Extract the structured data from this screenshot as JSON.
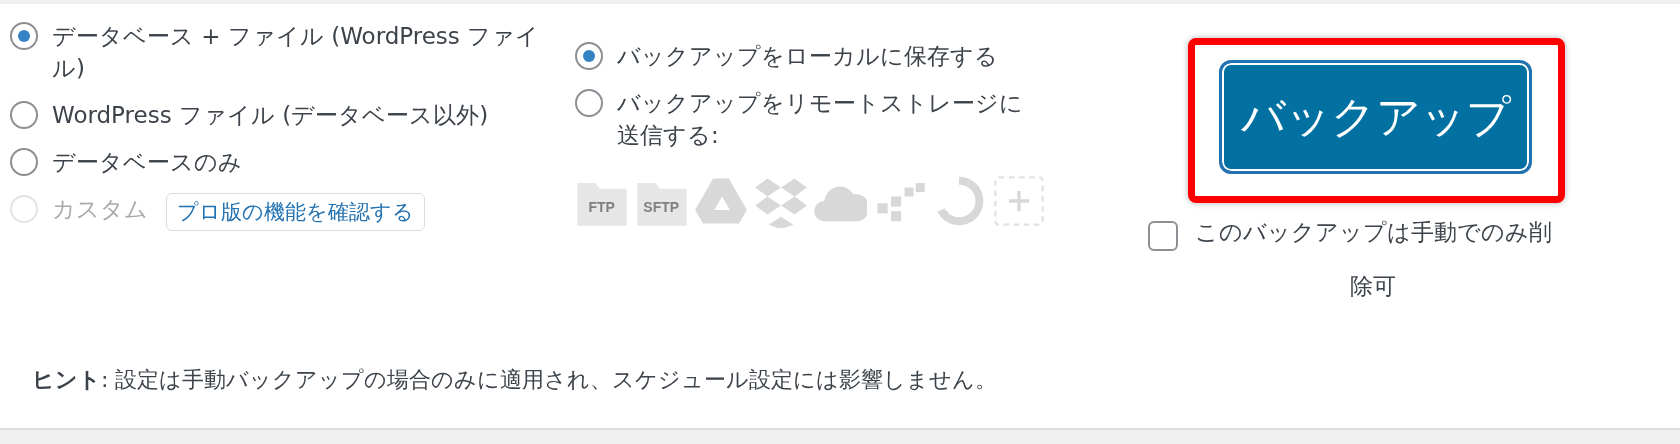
{
  "backup_contents": [
    {
      "label": "データベース + ファイル (WordPress ファイル)",
      "selected": true,
      "disabled": false
    },
    {
      "label": "WordPress ファイル (データベース以外)",
      "selected": false,
      "disabled": false
    },
    {
      "label": "データベースのみ",
      "selected": false,
      "disabled": false
    },
    {
      "label": "カスタム",
      "selected": false,
      "disabled": true
    }
  ],
  "pro_link": "プロ版の機能を確認する",
  "destinations": [
    {
      "label": "バックアップをローカルに保存する",
      "selected": true
    },
    {
      "label": "バックアップをリモートストレージに送信する:",
      "selected": false
    }
  ],
  "remote_services": [
    {
      "kind": "ftp",
      "label": "FTP"
    },
    {
      "kind": "sftp",
      "label": "SFTP"
    },
    {
      "kind": "drive"
    },
    {
      "kind": "dropbox"
    },
    {
      "kind": "cloud"
    },
    {
      "kind": "blocks"
    },
    {
      "kind": "sync"
    },
    {
      "kind": "add"
    }
  ],
  "backup_button": "バックアップ",
  "keep_checkbox": {
    "label": "このバックアップは手動でのみ削除可",
    "checked": false
  },
  "hint": "**ヒント**: 設定は手動バックアップの場合のみに適用され、スケジュール設定には影響しません。"
}
